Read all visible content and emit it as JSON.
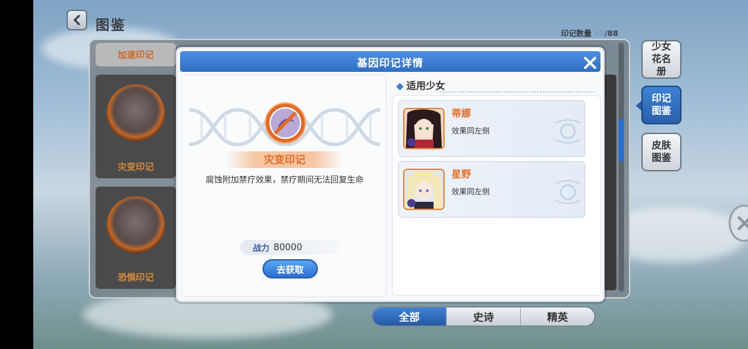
{
  "header": {
    "title": "图鉴",
    "count_label": "印记数量",
    "count_value": "80",
    "count_total": "/88"
  },
  "background_cards": [
    {
      "label": "加速印记"
    },
    {
      "label": "灾变印记"
    },
    {
      "label": "恐惧印记"
    }
  ],
  "side_tabs": [
    {
      "label": "少女花名册",
      "active": false
    },
    {
      "label": "印记图鉴",
      "active": true
    },
    {
      "label": "皮肤图鉴",
      "active": false
    }
  ],
  "filter_tabs": [
    {
      "label": "全部",
      "active": true
    },
    {
      "label": "史诗",
      "active": false
    },
    {
      "label": "精英",
      "active": false
    }
  ],
  "dialog": {
    "title": "基因印记详情",
    "close_icon": "close-icon",
    "mark_name": "灾变印记",
    "description": "腐蚀附加禁疗效果，禁疗期间无法回复生命",
    "power_label": "战力",
    "power_value": "80000",
    "acquire_label": "去获取",
    "section_title": "适用少女",
    "girls": [
      {
        "name": "蒂娜",
        "effect": "效果同左侧"
      },
      {
        "name": "星野",
        "effect": "效果同左侧"
      }
    ]
  },
  "colors": {
    "accent_blue": "#2f6fc4",
    "mark_orange": "#e06a2a",
    "girl_name_orange": "#e0702c"
  }
}
